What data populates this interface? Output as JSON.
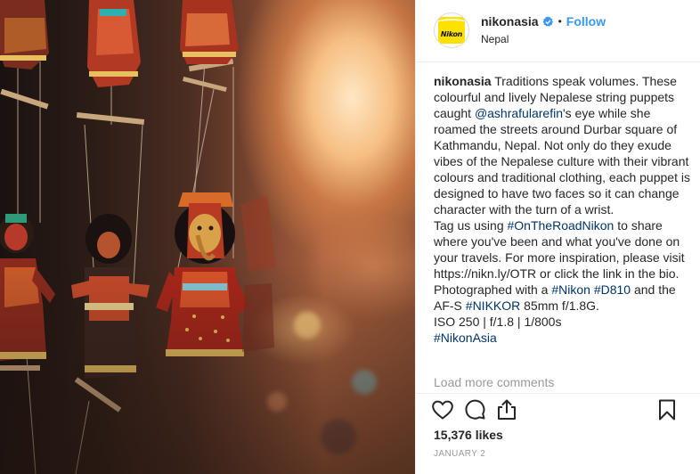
{
  "header": {
    "username": "nikonasia",
    "separator": "•",
    "follow_label": "Follow",
    "location": "Nepal",
    "avatar_logo_text": "Nikon"
  },
  "caption": {
    "username": "nikonasia",
    "p1_text_a": " Traditions speak volumes. These colourful and lively Nepalese string puppets caught ",
    "p1_mention": "@ashrafularefin",
    "p1_text_b": "'s eye while she roamed the streets around Durbar square of Kathmandu, Nepal. Not only do they exude vibes of the Nepalese culture with their vibrant colours and traditional clothing, each puppet is designed to have two faces so it can change character with the turn of a wrist.",
    "p2_text_a": "Tag us using ",
    "p2_hashtag": "#OnTheRoadNikon",
    "p2_text_b": " to share where you've been and what you've done on your travels. For more inspiration, please visit https://nikn.ly/OTR or click the link in the bio.",
    "p3_text_a": "Photographed with a ",
    "p3_hashtag_1": "#Nikon",
    "p3_hashtag_2": "#D810",
    "p3_text_b": " and the AF-S ",
    "p3_hashtag_3": "#NIKKOR",
    "p3_text_c": " 85mm f/1.8G.",
    "p4_text": "ISO 250 | f/1.8 | 1/800s",
    "p5_hashtag": "#NikonAsia"
  },
  "load_more_label": "Load more comments",
  "actions": {
    "like_icon": "heart-outline-icon",
    "comment_icon": "comment-bubble-icon",
    "share_icon": "share-upload-icon",
    "save_icon": "bookmark-icon"
  },
  "likes_text": "15,376 likes",
  "date_text": "January 2",
  "colors": {
    "link": "#003569",
    "follow": "#3897f0",
    "verified": "#3897f0",
    "muted": "#999999"
  }
}
